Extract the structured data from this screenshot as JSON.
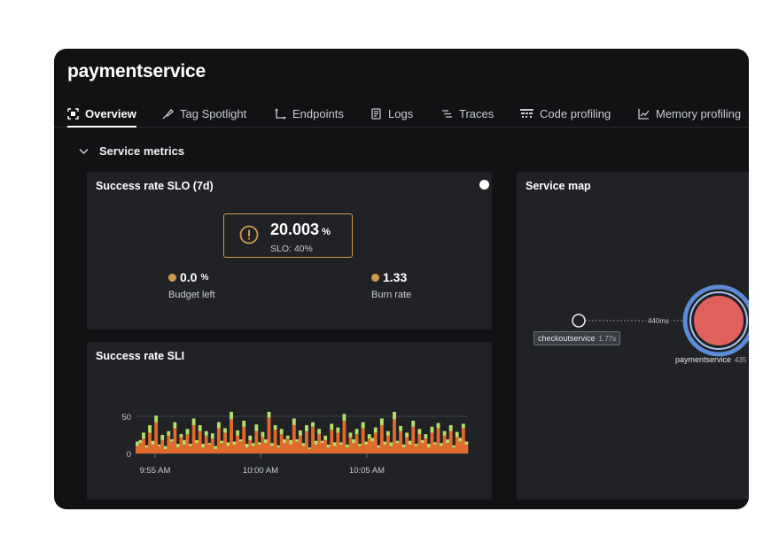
{
  "app": {
    "title": "paymentservice"
  },
  "tabs": [
    {
      "label": "Overview",
      "icon": "overview-icon",
      "active": true
    },
    {
      "label": "Tag Spotlight",
      "icon": "tag-icon"
    },
    {
      "label": "Endpoints",
      "icon": "endpoints-icon"
    },
    {
      "label": "Logs",
      "icon": "logs-icon"
    },
    {
      "label": "Traces",
      "icon": "traces-icon"
    },
    {
      "label": "Code profiling",
      "icon": "code-profiling-icon"
    },
    {
      "label": "Memory profiling",
      "icon": "memory-profiling-icon"
    }
  ],
  "section": {
    "label": "Service metrics",
    "icon": "chevron-down-icon"
  },
  "slo_card": {
    "title": "Success rate SLO (7d)",
    "value": "20.003",
    "unit": "%",
    "slo_label": "SLO: 40%",
    "budget_value": "0.0",
    "budget_unit": "%",
    "budget_label": "Budget left",
    "burn_value": "1.33",
    "burn_label": "Burn rate",
    "warning_icon": "warning-icon",
    "accent_color": "#d29a4a"
  },
  "service_map": {
    "title": "Service map",
    "edge_label": "440ms",
    "source_node": {
      "name": "checkoutservice",
      "latency": "1.77s"
    },
    "target_node": {
      "name": "paymentservice",
      "latency": "435"
    },
    "target_color": "#e0615c",
    "ring_color": "#5b8cd6"
  },
  "sli_card": {
    "title": "Success rate SLI"
  },
  "chart_data": {
    "type": "bar",
    "stacked": true,
    "y_ticks": [
      "50",
      "0"
    ],
    "x_ticks": [
      "9:55 AM",
      "10:00 AM",
      "10:05 AM"
    ],
    "ylim": [
      0,
      70
    ],
    "colors": {
      "base": "#e0692c",
      "top": "#b4e06a"
    },
    "series": [
      {
        "values": [
          10,
          14,
          20,
          8,
          28,
          12,
          42,
          10,
          18,
          6,
          24,
          16,
          34,
          8,
          22,
          12,
          26,
          10,
          38,
          14,
          30,
          8,
          24,
          12,
          20,
          6,
          34,
          14,
          28,
          10,
          46,
          12,
          24,
          16,
          36,
          8,
          18,
          10,
          30,
          12,
          22,
          14,
          48,
          10,
          32,
          8,
          26,
          14,
          20,
          12,
          38,
          16,
          24,
          10,
          30,
          6,
          36,
          12,
          26,
          14,
          18,
          8,
          32,
          10,
          28,
          12,
          44,
          8,
          22,
          14,
          26,
          10,
          34,
          12,
          20,
          16,
          28,
          8,
          38,
          12,
          24,
          10,
          46,
          14,
          30,
          8,
          22,
          12,
          36,
          10,
          26,
          14,
          20,
          8,
          28,
          12,
          34,
          10,
          24,
          14,
          30,
          8,
          22,
          16,
          34,
          12
        ]
      },
      {
        "values": [
          6,
          4,
          8,
          3,
          10,
          5,
          9,
          2,
          7,
          4,
          6,
          3,
          8,
          5,
          4,
          6,
          7,
          3,
          9,
          4,
          8,
          5,
          6,
          2,
          7,
          4,
          8,
          3,
          6,
          5,
          10,
          4,
          7,
          3,
          8,
          5,
          6,
          4,
          9,
          3,
          7,
          5,
          8,
          4,
          6,
          3,
          7,
          5,
          4,
          6,
          9,
          3,
          7,
          4,
          8,
          2,
          6,
          5,
          7,
          3,
          6,
          4,
          8,
          5,
          7,
          3,
          9,
          4,
          6,
          5,
          7,
          3,
          8,
          4,
          6,
          5,
          7,
          3,
          9,
          4,
          6,
          5,
          10,
          3,
          7,
          4,
          6,
          5,
          8,
          3,
          7,
          4,
          6,
          5,
          8,
          3,
          7,
          4,
          6,
          5,
          8,
          3,
          7,
          5,
          6,
          4
        ]
      }
    ]
  }
}
